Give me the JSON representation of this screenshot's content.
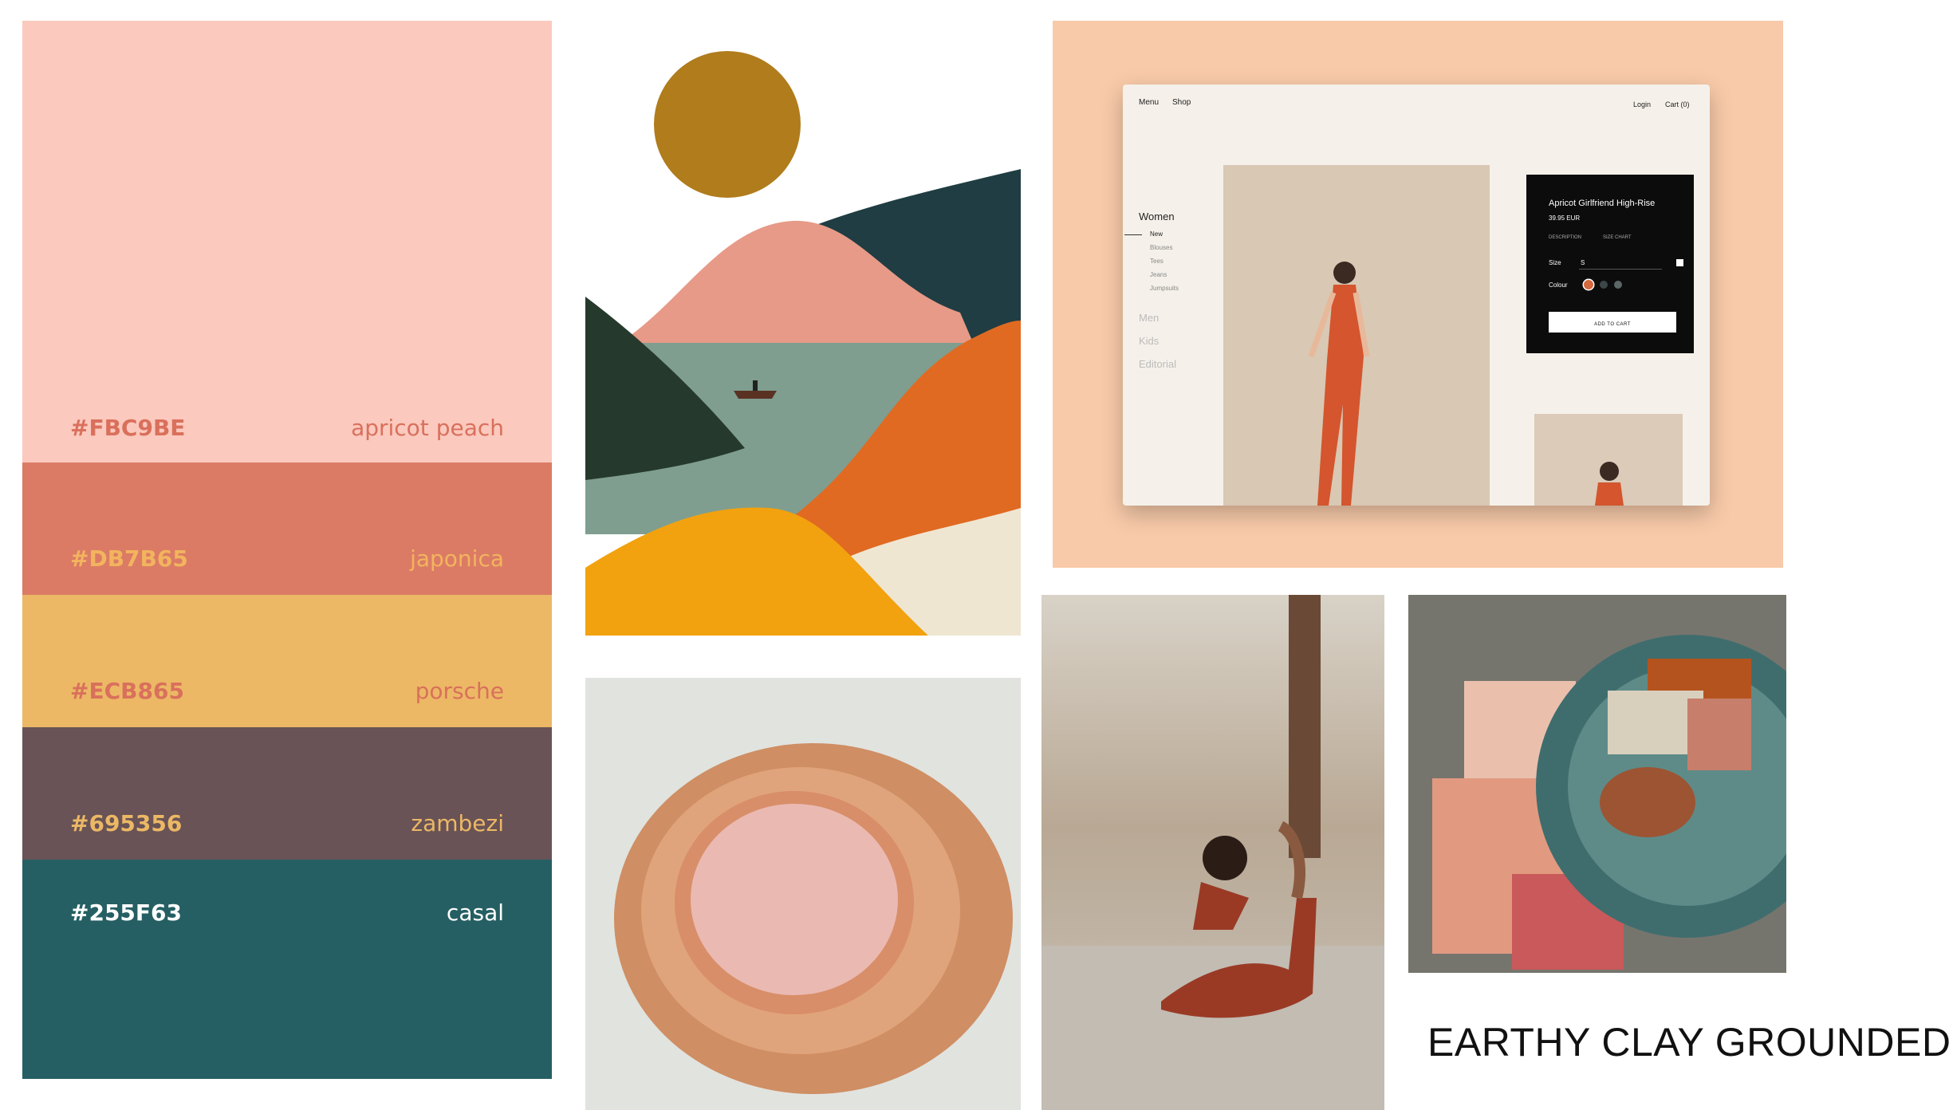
{
  "palette": {
    "swatches": [
      {
        "hex_label": "#FBC9BE",
        "name": "apricot peach",
        "color": "#FBC9BE",
        "text_color": "#d9705c"
      },
      {
        "hex_label": "#DB7B65",
        "name": "japonica",
        "color": "#DB7B65",
        "text_color": "#f2b45e"
      },
      {
        "hex_label": "#ECB865",
        "name": "porsche",
        "color": "#ECB865",
        "text_color": "#d9705c"
      },
      {
        "hex_label": "#695356",
        "name": "zambezi",
        "color": "#695356",
        "text_color": "#ecb865"
      },
      {
        "hex_label": "#255F63",
        "name": "casal",
        "color": "#255F63",
        "text_color": "#ffffff"
      }
    ]
  },
  "shop_mockup": {
    "nav": {
      "menu": "Menu",
      "shop": "Shop",
      "login": "Login",
      "cart": "Cart (0)"
    },
    "categories": {
      "women": "Women",
      "sub": [
        "New",
        "Blouses",
        "Tees",
        "Jeans",
        "Jumpsuits"
      ],
      "others": [
        "Men",
        "Kids",
        "Editorial"
      ]
    },
    "product": {
      "title": "Apricot Girlfriend High-Rise",
      "price": "39.95 EUR",
      "tab_description": "DESCRIPTION",
      "tab_size_chart": "SIZE CHART",
      "size_label": "Size",
      "size_value": "S",
      "colour_label": "Colour",
      "add_to_cart": "ADD TO CART"
    }
  },
  "caption": "EARTHY CLAY GROUNDED"
}
